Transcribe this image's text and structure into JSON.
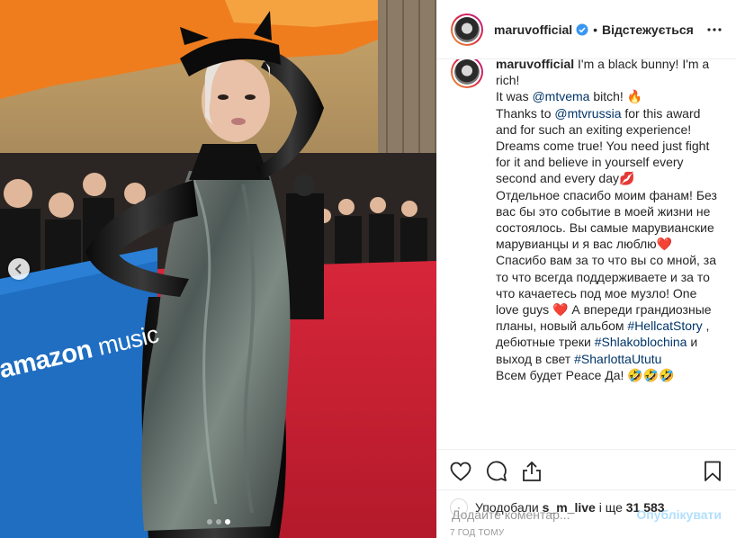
{
  "post": {
    "username": "maruvofficial",
    "separator": "•",
    "follow_status": "Відстежується",
    "caption_username": "maruvofficial",
    "caption_lines": [
      {
        "parts": [
          {
            "t": "I'm a black bunny! I'm a rich!"
          }
        ]
      },
      {
        "parts": [
          {
            "t": "It was "
          },
          {
            "t": "@mtvema",
            "link": true
          },
          {
            "t": " bitch! 🔥"
          }
        ]
      },
      {
        "parts": [
          {
            "t": "Thanks to "
          },
          {
            "t": "@mtvrussia",
            "link": true
          },
          {
            "t": " for this award and for such an exiting experience! Dreams come true! You need just fight for it and believe in yourself every second and every day💋"
          }
        ]
      },
      {
        "parts": [
          {
            "t": "Отдельное спасибо моим фанам! Без вас бы это событие в моей жизни не состоялось. Вы самые марувианские марувианцы и я вас люблю❤️ Спасибо вам за то что вы со мной, за то что всегда поддерживаете и за то что качаетесь под мое музло! One love guys ❤️ А впереди грандиозные планы, новый альбом "
          },
          {
            "t": "#HellcatStory",
            "link": true
          },
          {
            "t": " , дебютные треки "
          },
          {
            "t": "#Shlakoblochina",
            "link": true
          },
          {
            "t": " и выход в свет "
          },
          {
            "t": "#SharlottaUtutu",
            "link": true
          }
        ]
      },
      {
        "parts": [
          {
            "t": "Всем будет Peace Да! 🤣🤣🤣"
          }
        ]
      }
    ],
    "likes_prefix": "Уподобали",
    "liked_by": "s_m_live",
    "likes_mid": " і ще ",
    "likes_count": "31 583",
    "time_ago": "7 ГОД ТОМУ",
    "comment_placeholder": "Додайте коментар...",
    "publish_label": "Опублікувати"
  },
  "photo": {
    "brand_text": "amazon",
    "brand_text2": "music",
    "slides_total": 3,
    "active_slide": 3
  },
  "icons": {
    "verified": "verified-badge-icon",
    "more": "more-options-icon",
    "like": "heart-icon",
    "comment": "comment-icon",
    "share": "share-icon",
    "save": "bookmark-icon",
    "prev": "chevron-left-icon"
  },
  "colors": {
    "accent": "#3897f0",
    "link": "#003569",
    "publish_disabled": "#b2dffc",
    "muted": "#999999",
    "carpet": "#c8202e",
    "banner": "#1f6ec2"
  }
}
